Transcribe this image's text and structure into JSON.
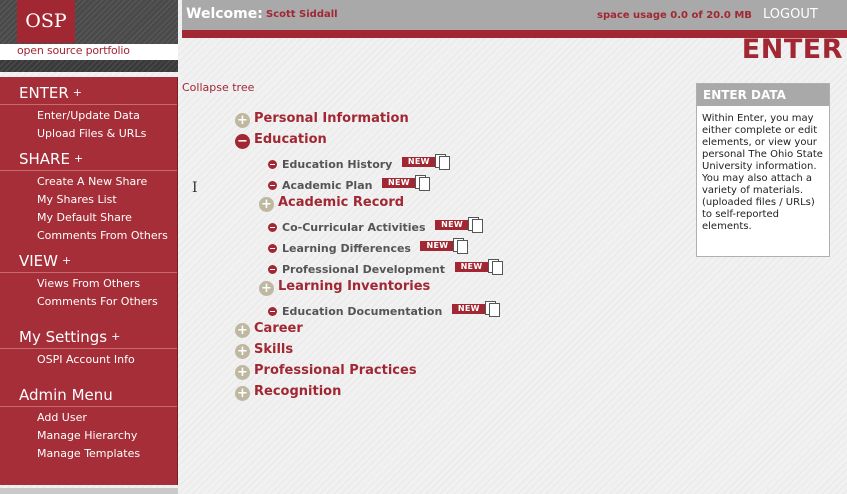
{
  "logo": {
    "badge": "OSP",
    "tagline": "open source portfolio"
  },
  "header": {
    "welcome_label": "Welcome:",
    "user_name": "Scott Siddall",
    "space_usage": "space usage 0.0 of 20.0 MB",
    "logout": "LOGOUT",
    "page_title": "ENTER"
  },
  "sidebar": {
    "sections": [
      {
        "title": "ENTER",
        "links": [
          "Enter/Update Data",
          "Upload Files & URLs"
        ]
      },
      {
        "title": "SHARE",
        "links": [
          "Create A New Share",
          "My Shares List",
          "My Default Share",
          "Comments From Others"
        ]
      },
      {
        "title": "VIEW",
        "links": [
          "Views From Others",
          "Comments For Others"
        ]
      },
      {
        "title": "My Settings",
        "links": [
          "OSPI Account Info"
        ]
      },
      {
        "title": "Admin Menu",
        "links": [
          "Add User",
          "Manage Hierarchy",
          "Manage Templates"
        ]
      }
    ],
    "plus_glyph": "+"
  },
  "tree": {
    "collapse_label": "Collapse tree",
    "new_label": "NEW",
    "rows": [
      {
        "label": "Personal Information",
        "kind": "category",
        "state": "collapsed"
      },
      {
        "label": "Education",
        "kind": "category",
        "state": "expanded"
      },
      {
        "label": "Education History",
        "kind": "leaf"
      },
      {
        "label": "Academic Plan",
        "kind": "leaf"
      },
      {
        "label": "Academic Record",
        "kind": "category",
        "state": "collapsed"
      },
      {
        "label": "Co-Curricular Activities",
        "kind": "leaf"
      },
      {
        "label": "Learning Differences",
        "kind": "leaf"
      },
      {
        "label": "Professional Development",
        "kind": "leaf"
      },
      {
        "label": "Learning Inventories",
        "kind": "category",
        "state": "collapsed"
      },
      {
        "label": "Education Documentation",
        "kind": "leaf"
      },
      {
        "label": "Career",
        "kind": "category",
        "state": "collapsed"
      },
      {
        "label": "Skills",
        "kind": "category",
        "state": "collapsed"
      },
      {
        "label": "Professional Practices",
        "kind": "category",
        "state": "collapsed"
      },
      {
        "label": "Recognition",
        "kind": "category",
        "state": "collapsed"
      }
    ]
  },
  "infobox": {
    "title": "ENTER DATA",
    "body": "Within Enter, you may either complete or edit elements, or view your personal The Ohio State University information.  You may also attach a variety of materials. (uploaded files / URLs) to self-reported elements."
  },
  "colors": {
    "brand": "#a12833",
    "bar": "#a9a9a9",
    "sidebar": "#a52e38"
  },
  "icons": [
    "plus-circle-icon",
    "minus-circle-icon",
    "bullet-icon",
    "new-document-icon",
    "ibeam-cursor-icon"
  ]
}
